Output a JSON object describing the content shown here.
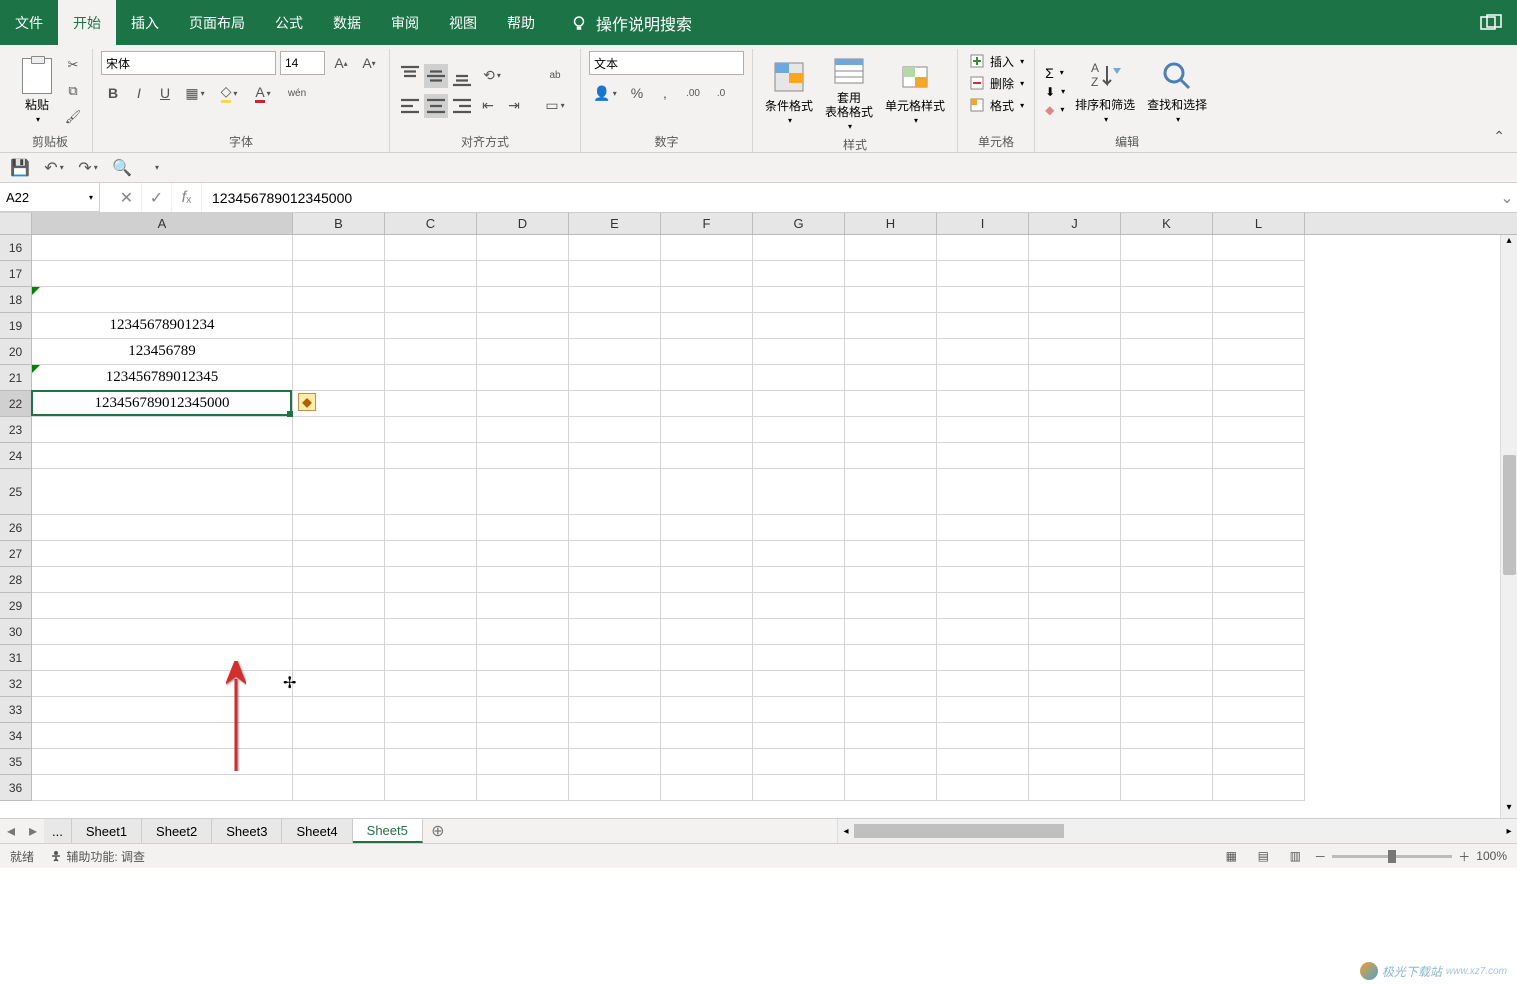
{
  "menu": {
    "tabs": [
      "文件",
      "开始",
      "插入",
      "页面布局",
      "公式",
      "数据",
      "审阅",
      "视图",
      "帮助"
    ],
    "active_index": 1,
    "search_placeholder": "操作说明搜索"
  },
  "ribbon": {
    "clipboard": {
      "paste_label": "粘贴",
      "group_label": "剪贴板"
    },
    "font": {
      "name": "宋体",
      "size": "14",
      "bold": "B",
      "italic": "I",
      "underline": "U",
      "pinyin": "wén",
      "group_label": "字体"
    },
    "alignment": {
      "group_label": "对齐方式"
    },
    "number": {
      "format": "文本",
      "group_label": "数字"
    },
    "styles": {
      "conditional": "条件格式",
      "table": "套用\n表格格式",
      "cell": "单元格样式",
      "group_label": "样式"
    },
    "cells": {
      "insert": "插入",
      "delete": "删除",
      "format": "格式",
      "group_label": "单元格"
    },
    "editing": {
      "sort": "排序和筛选",
      "find": "查找和选择",
      "group_label": "编辑"
    }
  },
  "name_box": "A22",
  "formula_bar_value": "123456789012345000",
  "columns": [
    "A",
    "B",
    "C",
    "D",
    "E",
    "F",
    "G",
    "H",
    "I",
    "J",
    "K",
    "L"
  ],
  "visible_rows": [
    16,
    17,
    18,
    19,
    20,
    21,
    22,
    23,
    24,
    25,
    26,
    27,
    28,
    29,
    30,
    31,
    32,
    33,
    34,
    35,
    36
  ],
  "selected_cell_row": 22,
  "cells_data": {
    "A19": "12345678901234",
    "A20": "123456789",
    "A21": "123456789012345",
    "A22": "123456789012345000"
  },
  "sheet_tabs": {
    "ellipsis": "...",
    "tabs": [
      "Sheet1",
      "Sheet2",
      "Sheet3",
      "Sheet4",
      "Sheet5"
    ],
    "active_index": 4
  },
  "status": {
    "ready": "就绪",
    "accessibility": "辅助功能: 调查",
    "zoom": "100%"
  },
  "watermark": "极光下载站"
}
